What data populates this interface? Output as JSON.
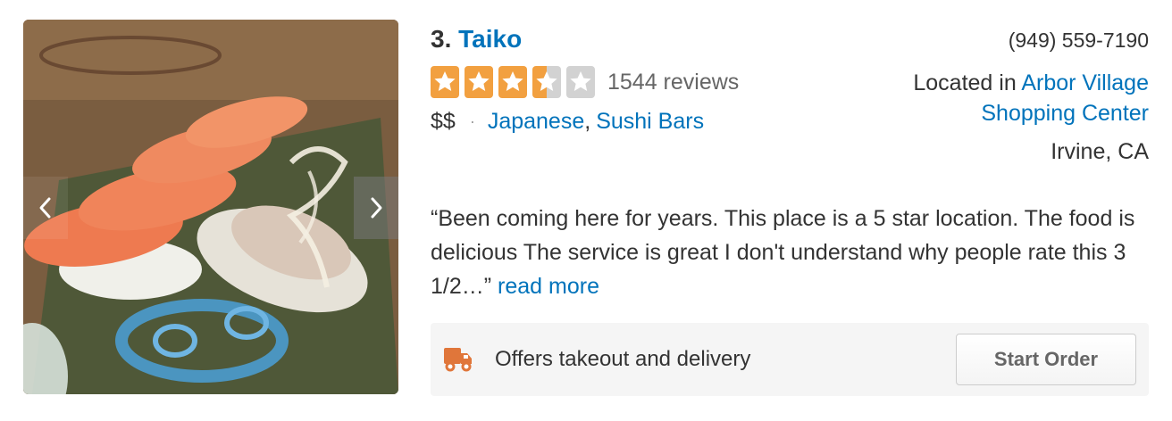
{
  "business": {
    "rank": "3.",
    "name": "Taiko",
    "rating": 3.5,
    "review_count_text": "1544 reviews",
    "price": "$$",
    "separator": "·",
    "categories": [
      "Japanese",
      "Sushi Bars"
    ],
    "category_comma": ",",
    "phone": "(949) 559-7190",
    "location_prefix": "Located in",
    "location_link": "Arbor Village Shopping Center",
    "city": "Irvine, CA"
  },
  "review": {
    "snippet": "“Been coming here for years. This place is a 5 star location. The food is delicious  The service is great  I don't understand why people rate this 3 1/2…”",
    "read_more": "read more"
  },
  "order": {
    "text": "Offers takeout and delivery",
    "button_label": "Start Order",
    "icon": "truck-icon"
  },
  "photo": {
    "subject": "sushi-photo",
    "prev_icon": "chevron-left-icon",
    "next_icon": "chevron-right-icon"
  },
  "colors": {
    "link": "#0073bb",
    "star_active": "#f2a040",
    "star_inactive": "#d2d2d2",
    "truck": "#e0763a"
  }
}
